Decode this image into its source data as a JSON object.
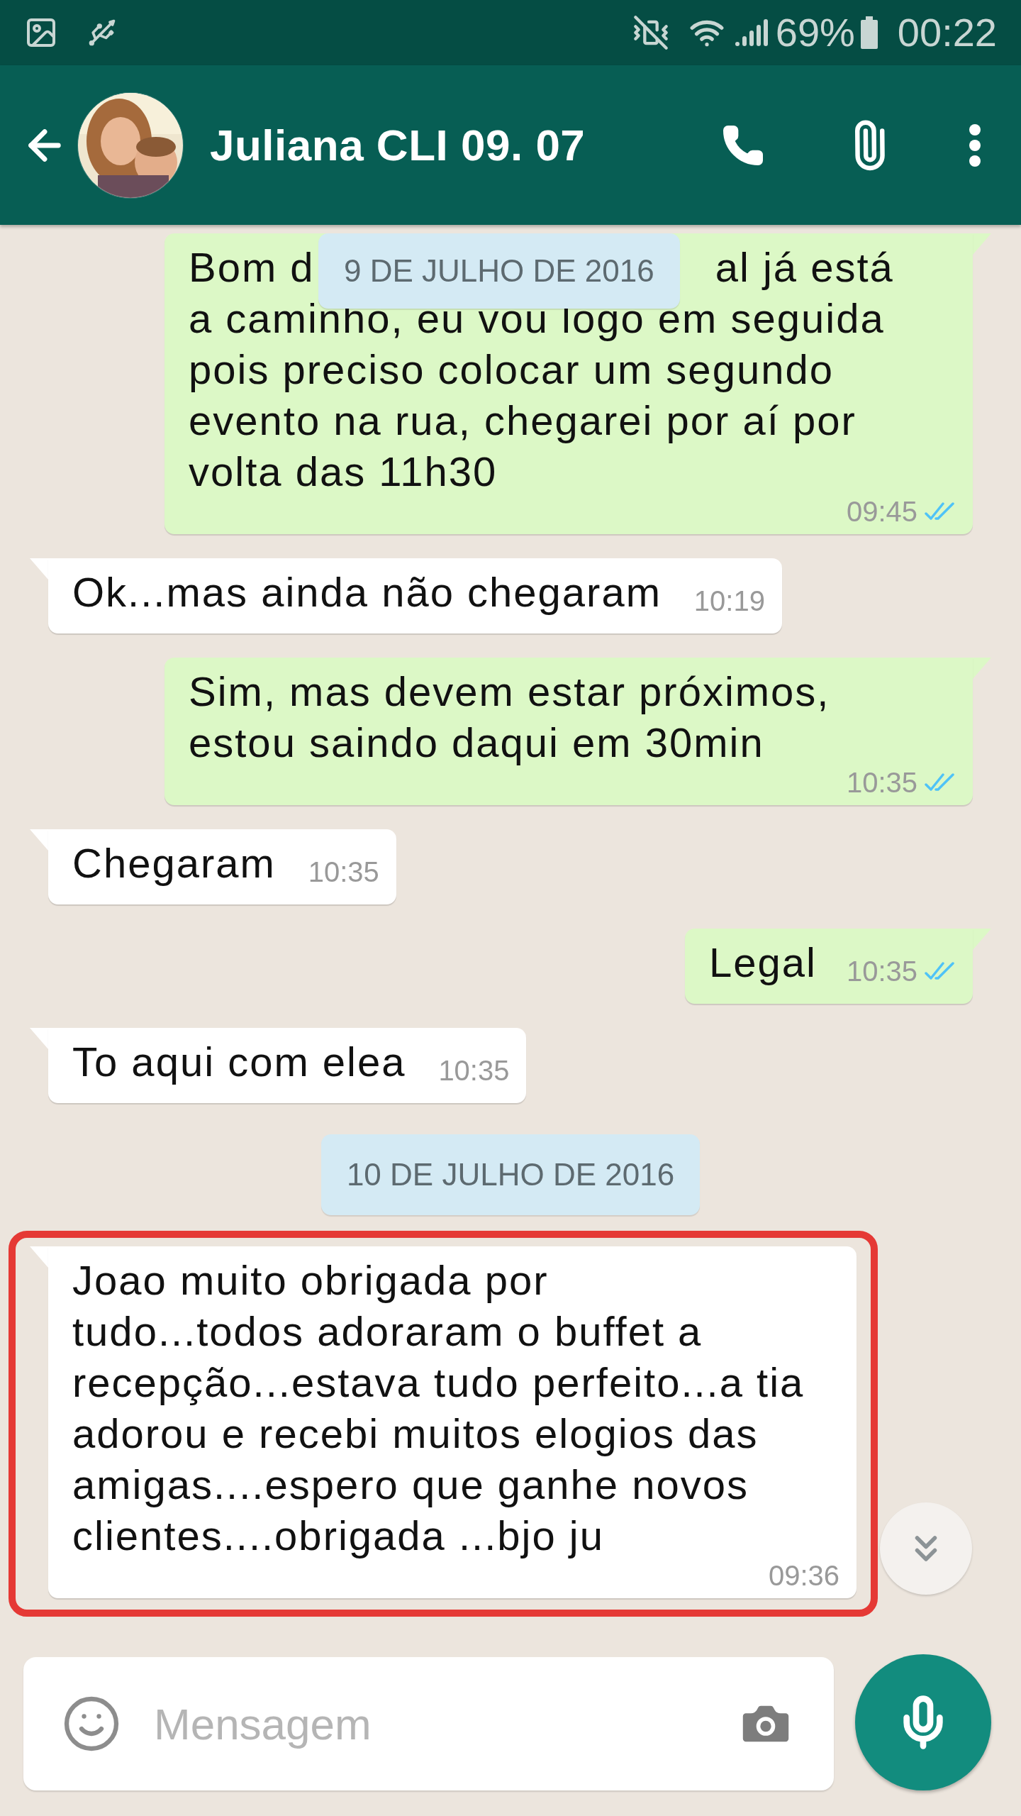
{
  "status_bar": {
    "battery": "69%",
    "time": "00:22"
  },
  "header": {
    "title": "Juliana CLI 09. 07"
  },
  "floating_date": "9 DE JULHO DE 2016",
  "messages": [
    {
      "kind": "outgoing",
      "covered_first_line": [
        "Bom d",
        "al já está"
      ],
      "text": "a caminho, eu vou logo em seguida\npois preciso colocar um segundo\nevento na rua, chegarei por aí por\nvolta das 11h30",
      "time": "09:45",
      "read": true,
      "highlighted": false
    },
    {
      "kind": "incoming",
      "text": "Ok...mas ainda não chegaram",
      "time": "10:19",
      "highlighted": false
    },
    {
      "kind": "outgoing",
      "text": "Sim, mas devem estar próximos,\nestou saindo daqui em 30min",
      "time": "10:35",
      "read": true,
      "highlighted": false
    },
    {
      "kind": "incoming",
      "text": "Chegaram",
      "time": "10:35",
      "highlighted": false
    },
    {
      "kind": "outgoing",
      "text": "Legal",
      "time": "10:35",
      "read": true,
      "highlighted": false
    },
    {
      "kind": "incoming",
      "text": "To aqui com elea",
      "time": "10:35",
      "highlighted": false
    },
    {
      "kind": "date",
      "text": "10 DE JULHO DE 2016"
    },
    {
      "kind": "incoming",
      "text": "Joao muito obrigada por\ntudo...todos adoraram o buffet a\nrecepção...estava tudo perfeito...a tia\nadorou e recebi muitos elogios das\namigas....espero que ganhe novos\nclientes....obrigada ...bjo ju",
      "time": "09:36",
      "highlighted": true
    }
  ],
  "composer": {
    "placeholder": "Mensagem"
  }
}
